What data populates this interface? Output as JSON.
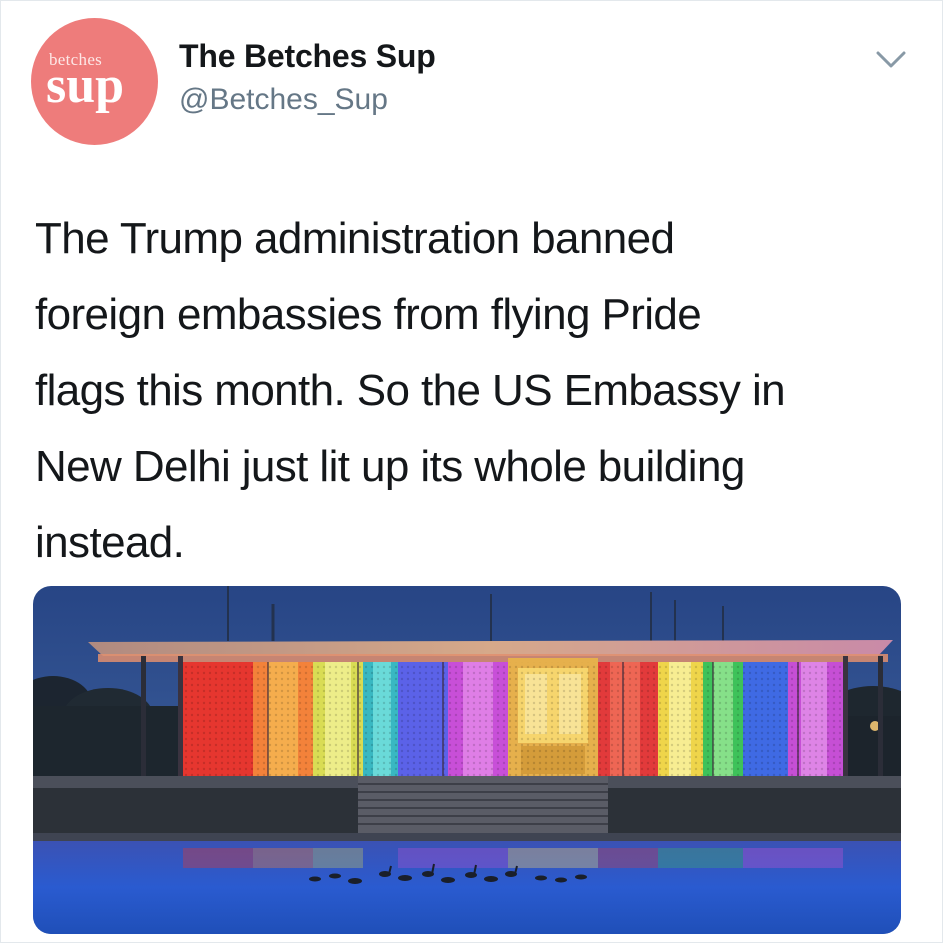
{
  "account": {
    "avatar_small_text": "betches",
    "avatar_big_text": "sup",
    "display_name": "The Betches Sup",
    "handle": "@Betches_Sup",
    "avatar_color": "#ee7c7b"
  },
  "menu": {
    "icon": "chevron-down-icon"
  },
  "tweet": {
    "text": "The Trump administration banned\nforeign embassies from flying Pride\nflags this month. So the US Embassy in\nNew Delhi just lit up its whole building\ninstead."
  },
  "photo": {
    "subject": "embassy building lit in rainbow colors at night",
    "colors": {
      "sky": "#2b4a86",
      "water": "#2a58c8",
      "red": "#e83a2e",
      "orange": "#f07a2a",
      "yellow": "#f0d64a",
      "green": "#53c24f",
      "cyan": "#2fb6c8",
      "blue": "#3d5fe0",
      "violet": "#9a3fd8",
      "pink": "#d845c6"
    }
  }
}
